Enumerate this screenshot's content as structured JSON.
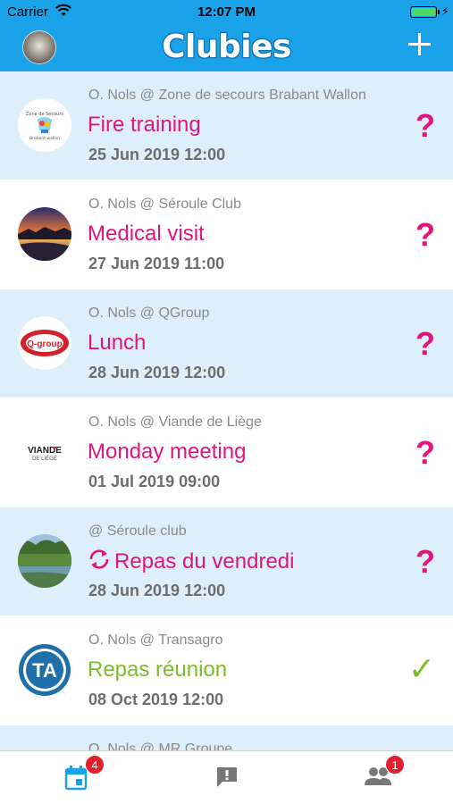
{
  "status_bar": {
    "carrier": "Carrier",
    "time": "12:07 PM"
  },
  "nav": {
    "logo": "Clubies"
  },
  "events": [
    {
      "organizer": "O. Nols @ Zone de secours Brabant Wallon",
      "title": "Fire training",
      "date": "25 Jun 2019 12:00",
      "status": "?",
      "logo": "zone-de-secours-logo"
    },
    {
      "organizer": "O. Nols @ Séroule Club",
      "title": "Medical visit",
      "date": "27 Jun 2019 11:00",
      "status": "?",
      "logo": "sunset-lake-photo"
    },
    {
      "organizer": "O. Nols @ QGroup",
      "title": "Lunch",
      "date": "28 Jun 2019 12:00",
      "status": "?",
      "logo": "q-group-logo",
      "logo_text": "Q-group"
    },
    {
      "organizer": "O. Nols @ Viande de Liège",
      "title": "Monday meeting",
      "date": "01 Jul 2019 09:00",
      "status": "?",
      "logo": "viande-de-liege-logo",
      "logo_text": "VIANDE",
      "logo_subtext": "DE LIÈGE"
    },
    {
      "organizer": "@ Séroule club",
      "title": "Repas du vendredi",
      "date": "28 Jun 2019 12:00",
      "status": "?",
      "logo": "forest-river-photo",
      "recurring": true
    },
    {
      "organizer": "O. Nols @ Transagro",
      "title": "Repas réunion",
      "date": "08 Oct 2019 12:00",
      "status": "✓",
      "logo": "transagro-logo",
      "logo_text": "TA"
    },
    {
      "organizer": "O. Nols @ MR Groupe"
    }
  ],
  "tabs": [
    {
      "name": "calendar",
      "icon": "calendar-icon",
      "badge": "4",
      "active": true
    },
    {
      "name": "alerts",
      "icon": "alert-message-icon"
    },
    {
      "name": "members",
      "icon": "people-icon",
      "badge": "1"
    }
  ],
  "colors": {
    "header": "#1aa3e8",
    "pending": "#e2147d",
    "accepted": "#7cbd2a",
    "shaded_row": "#ddeffa",
    "badge": "#e0202e"
  }
}
